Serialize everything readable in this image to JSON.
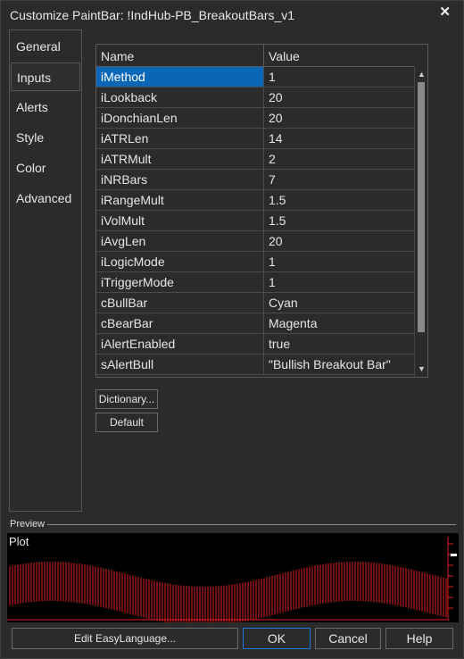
{
  "window": {
    "title": "Customize PaintBar: !IndHub-PB_BreakoutBars_v1",
    "close_symbol": "✕"
  },
  "tabs": [
    {
      "label": "General"
    },
    {
      "label": "Inputs"
    },
    {
      "label": "Alerts"
    },
    {
      "label": "Style"
    },
    {
      "label": "Color"
    },
    {
      "label": "Advanced"
    }
  ],
  "active_tab": "Inputs",
  "inputs": {
    "headers": {
      "name": "Name",
      "value": "Value"
    },
    "selected_row": "iMethod",
    "rows": [
      {
        "name": "iMethod",
        "value": "1"
      },
      {
        "name": "iLookback",
        "value": "20"
      },
      {
        "name": "iDonchianLen",
        "value": "20"
      },
      {
        "name": "iATRLen",
        "value": "14"
      },
      {
        "name": "iATRMult",
        "value": "2"
      },
      {
        "name": "iNRBars",
        "value": "7"
      },
      {
        "name": "iRangeMult",
        "value": "1.5"
      },
      {
        "name": "iVolMult",
        "value": "1.5"
      },
      {
        "name": "iAvgLen",
        "value": "20"
      },
      {
        "name": "iLogicMode",
        "value": "1"
      },
      {
        "name": "iTriggerMode",
        "value": "1"
      },
      {
        "name": "cBullBar",
        "value": "Cyan"
      },
      {
        "name": "cBearBar",
        "value": "Magenta"
      },
      {
        "name": "iAlertEnabled",
        "value": "true"
      },
      {
        "name": "sAlertBull",
        "value": "\"Bullish Breakout Bar\""
      }
    ]
  },
  "buttons": {
    "dictionary": "Dictionary...",
    "default": "Default"
  },
  "preview": {
    "label": "Preview",
    "plot_label": "Plot",
    "bar_color": "#e02020"
  },
  "footer": {
    "edit": "Edit EasyLanguage...",
    "ok": "OK",
    "cancel": "Cancel",
    "help": "Help"
  },
  "colors": {
    "selection": "#0a67b8",
    "background": "#2b2b2b",
    "ok_border": "#1e78d6"
  }
}
